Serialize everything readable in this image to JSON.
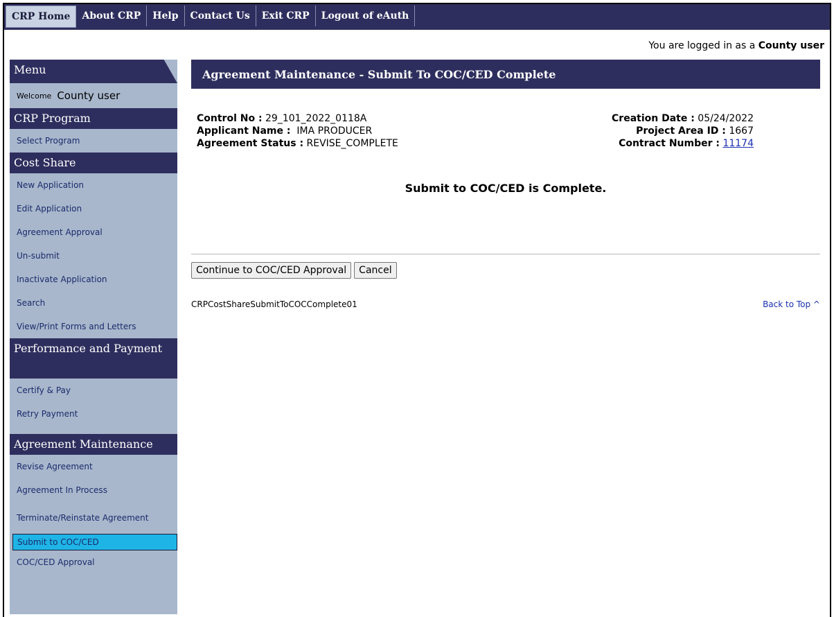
{
  "topnav": {
    "tabs": [
      {
        "label": "CRP Home"
      },
      {
        "label": "About CRP"
      },
      {
        "label": "Help"
      },
      {
        "label": "Contact Us"
      },
      {
        "label": "Exit CRP"
      },
      {
        "label": "Logout of eAuth"
      }
    ]
  },
  "login": {
    "prefix": "You are logged in as a",
    "user": "County user"
  },
  "sidebar": {
    "menu_title": "Menu",
    "welcome_label": "Welcome",
    "welcome_name": "County user",
    "crp_program": {
      "title": "CRP Program",
      "items": [
        "Select Program"
      ]
    },
    "cost_share": {
      "title": "Cost Share",
      "items": [
        "New Application",
        "Edit Application",
        "Agreement Approval",
        "Un-submit",
        "Inactivate Application",
        "Search",
        "View/Print Forms and Letters"
      ]
    },
    "performance": {
      "title": "Performance and Payment",
      "items": [
        "Certify & Pay",
        "Retry Payment"
      ]
    },
    "agreement_maintenance": {
      "title": "Agreement Maintenance",
      "items": [
        "Revise Agreement",
        "Agreement In Process",
        "Terminate/Reinstate Agreement",
        "Submit to COC/CED",
        "COC/CED Approval"
      ],
      "active": "Submit to COC/CED"
    }
  },
  "main": {
    "title": "Agreement Maintenance - Submit To COC/CED Complete",
    "control_no_label": "Control No :",
    "control_no": "29_101_2022_0118A",
    "applicant_label": "Applicant Name :",
    "applicant": "IMA PRODUCER",
    "status_label": "Agreement Status :",
    "status": "REVISE_COMPLETE",
    "creation_label": "Creation Date :",
    "creation": "05/24/2022",
    "project_label": "Project Area ID :",
    "project": "1667",
    "contract_label": "Contract Number :",
    "contract": "11174",
    "message": "Submit to COC/CED is Complete.",
    "continue_button": "Continue to COC/CED Approval",
    "cancel_button": "Cancel",
    "page_id": "CRPCostShareSubmitToCOCComplete01",
    "back_to_top": "Back to Top ^"
  },
  "colors": {
    "nav": "#2e2e5e",
    "sidebar": "#a8b7cc",
    "active": "#1fb4e6",
    "link": "#1a2fb0"
  }
}
